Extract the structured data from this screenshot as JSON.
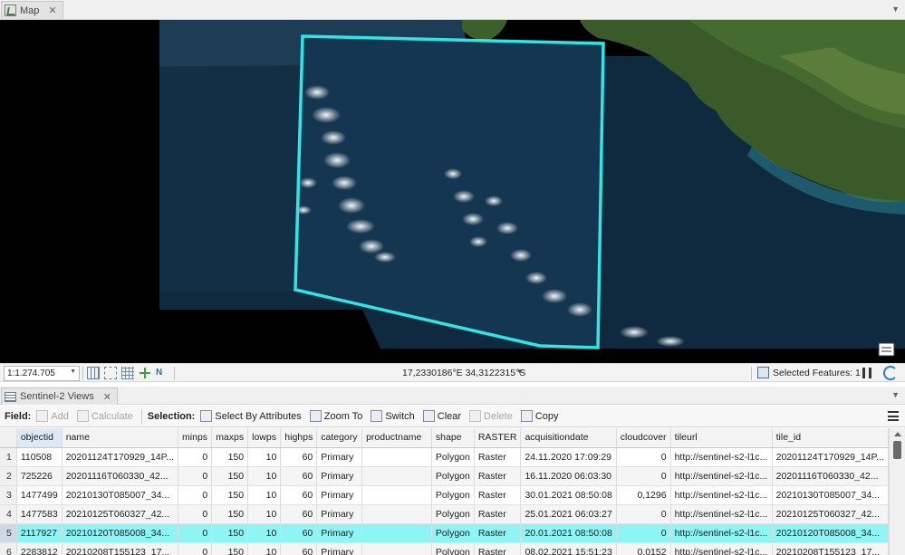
{
  "map_tab": {
    "title": "Map",
    "close": "✕"
  },
  "status": {
    "scale": "1:1.274.705",
    "coords": "17,2330186°E 34,3122315°S",
    "selected_features": "Selected Features: 1"
  },
  "table_tab": {
    "title": "Sentinel-2 Views",
    "close": "✕"
  },
  "toolbar": {
    "field_label": "Field:",
    "add": "Add",
    "calculate": "Calculate",
    "selection_label": "Selection:",
    "select_by_attributes": "Select By Attributes",
    "zoom_to": "Zoom To",
    "switch": "Switch",
    "clear": "Clear",
    "delete": "Delete",
    "copy": "Copy"
  },
  "table": {
    "columns": [
      "objectid",
      "name",
      "minps",
      "maxps",
      "lowps",
      "highps",
      "category",
      "productname",
      "shape",
      "RASTER",
      "acquisitiondate",
      "cloudcover",
      "tileurl",
      "tile_id"
    ],
    "rows": [
      {
        "rownum": "1",
        "objectid": "110508",
        "name": "20201124T170929_14P...",
        "minps": "0",
        "maxps": "150",
        "lowps": "10",
        "highps": "60",
        "category": "Primary",
        "productname": "",
        "shape": "Polygon",
        "raster": "Raster",
        "acquisitiondate": "24.11.2020 17:09:29",
        "cloudcover": "0",
        "tileurl": "http://sentinel-s2-l1c...",
        "tile_id": "20201124T170929_14P..."
      },
      {
        "rownum": "2",
        "objectid": "725226",
        "name": "20201116T060330_42...",
        "minps": "0",
        "maxps": "150",
        "lowps": "10",
        "highps": "60",
        "category": "Primary",
        "productname": "",
        "shape": "Polygon",
        "raster": "Raster",
        "acquisitiondate": "16.11.2020 06:03:30",
        "cloudcover": "0",
        "tileurl": "http://sentinel-s2-l1c...",
        "tile_id": "20201116T060330_42..."
      },
      {
        "rownum": "3",
        "objectid": "1477499",
        "name": "20210130T085007_34...",
        "minps": "0",
        "maxps": "150",
        "lowps": "10",
        "highps": "60",
        "category": "Primary",
        "productname": "",
        "shape": "Polygon",
        "raster": "Raster",
        "acquisitiondate": "30.01.2021 08:50:08",
        "cloudcover": "0,1296",
        "tileurl": "http://sentinel-s2-l1c...",
        "tile_id": "20210130T085007_34..."
      },
      {
        "rownum": "4",
        "objectid": "1477583",
        "name": "20210125T060327_42...",
        "minps": "0",
        "maxps": "150",
        "lowps": "10",
        "highps": "60",
        "category": "Primary",
        "productname": "",
        "shape": "Polygon",
        "raster": "Raster",
        "acquisitiondate": "25.01.2021 06:03:27",
        "cloudcover": "0",
        "tileurl": "http://sentinel-s2-l1c...",
        "tile_id": "20210125T060327_42..."
      },
      {
        "rownum": "5",
        "objectid": "2117927",
        "name": "20210120T085008_34...",
        "minps": "0",
        "maxps": "150",
        "lowps": "10",
        "highps": "60",
        "category": "Primary",
        "productname": "",
        "shape": "Polygon",
        "raster": "Raster",
        "acquisitiondate": "20.01.2021 08:50:08",
        "cloudcover": "0",
        "tileurl": "http://sentinel-s2-l1c...",
        "tile_id": "20210120T085008_34...",
        "selected": true
      },
      {
        "rownum": "6",
        "objectid": "2283812",
        "name": "20210208T155123_17...",
        "minps": "0",
        "maxps": "150",
        "lowps": "10",
        "highps": "60",
        "category": "Primary",
        "productname": "",
        "shape": "Polygon",
        "raster": "Raster",
        "acquisitiondate": "08.02.2021 15:51:23",
        "cloudcover": "0,0152",
        "tileurl": "http://sentinel-s2-l1c...",
        "tile_id": "20210208T155123_17..."
      }
    ]
  },
  "colors": {
    "selection_outline": "#2ee6e6",
    "selected_row": "#8ef4f4",
    "ocean": "#0f2a3f",
    "land": "#3a5a2a"
  }
}
